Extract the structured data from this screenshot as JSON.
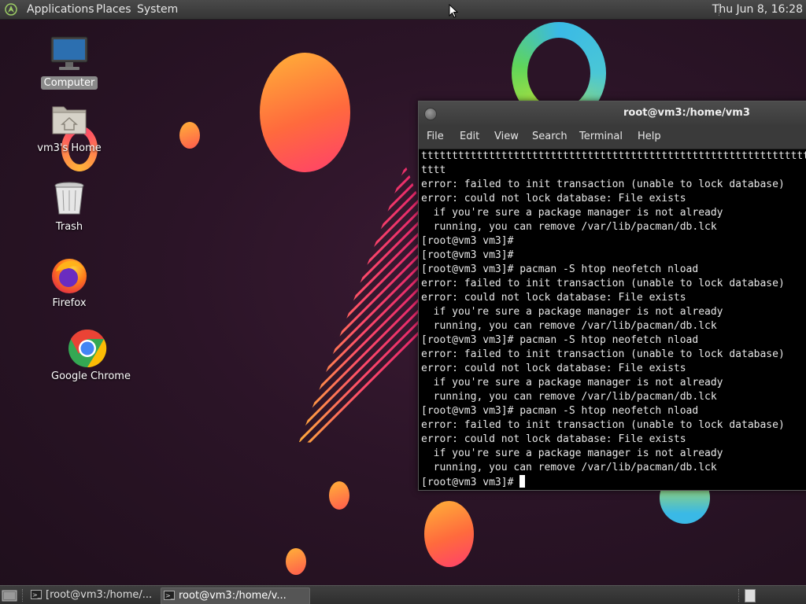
{
  "top_panel": {
    "menus": [
      "Applications",
      "Places",
      "System"
    ],
    "clock": "Thu Jun  8, 16:28"
  },
  "desktop": {
    "icons": [
      {
        "label": "Computer",
        "icon": "computer-icon",
        "selected": true
      },
      {
        "label": "vm3's Home",
        "icon": "home-folder-icon",
        "selected": false
      },
      {
        "label": "Trash",
        "icon": "trash-icon",
        "selected": false
      },
      {
        "label": "Firefox",
        "icon": "firefox-icon",
        "selected": false
      },
      {
        "label": "Google Chrome",
        "icon": "chrome-icon",
        "selected": false
      }
    ]
  },
  "terminal": {
    "title": "root@vm3:/home/vm3",
    "menu": [
      "File",
      "Edit",
      "View",
      "Search",
      "Terminal",
      "Help"
    ],
    "lines": [
      "tttttttttttttttttttttttttttttttttttttttttttttttttttttttttttttttt",
      "tttt",
      "error: failed to init transaction (unable to lock database)",
      "error: could not lock database: File exists",
      "  if you're sure a package manager is not already",
      "  running, you can remove /var/lib/pacman/db.lck",
      "[root@vm3 vm3]#",
      "[root@vm3 vm3]#",
      "[root@vm3 vm3]# pacman -S htop neofetch nload",
      "error: failed to init transaction (unable to lock database)",
      "error: could not lock database: File exists",
      "  if you're sure a package manager is not already",
      "  running, you can remove /var/lib/pacman/db.lck",
      "[root@vm3 vm3]# pacman -S htop neofetch nload",
      "error: failed to init transaction (unable to lock database)",
      "error: could not lock database: File exists",
      "  if you're sure a package manager is not already",
      "  running, you can remove /var/lib/pacman/db.lck",
      "[root@vm3 vm3]# pacman -S htop neofetch nload",
      "error: failed to init transaction (unable to lock database)",
      "error: could not lock database: File exists",
      "  if you're sure a package manager is not already",
      "  running, you can remove /var/lib/pacman/db.lck"
    ],
    "prompt": "[root@vm3 vm3]# "
  },
  "bottom_panel": {
    "tasks": [
      {
        "label": "[root@vm3:/home/...",
        "active": false
      },
      {
        "label": "root@vm3:/home/v...",
        "active": true
      }
    ]
  },
  "colors": {
    "wallpaper": "#2b1427",
    "accent_orange": "#ff6a3d",
    "panel": "#3a3a3a",
    "terminal_bg": "#000000"
  }
}
